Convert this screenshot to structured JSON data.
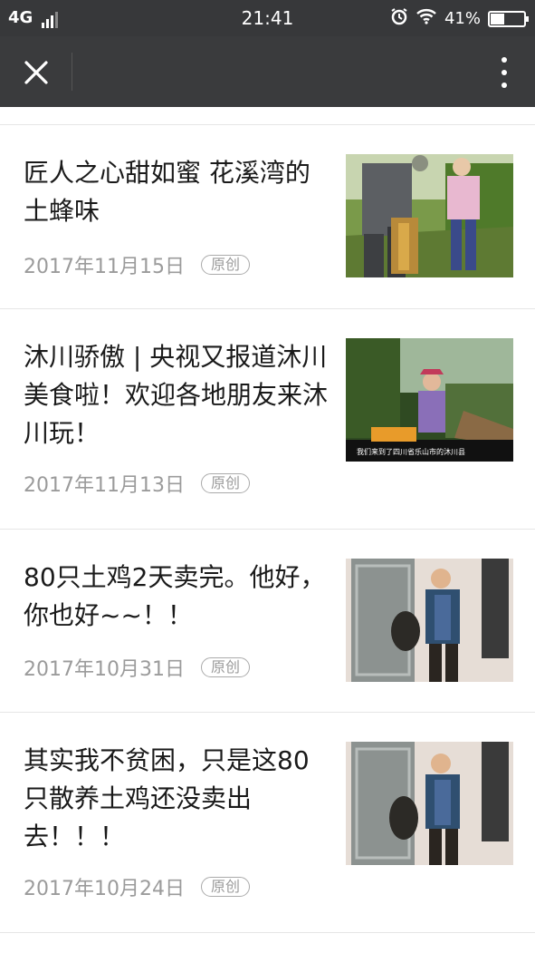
{
  "status_bar": {
    "network": "4G",
    "time": "21:41",
    "battery_percent": "41%",
    "battery_level": 0.41
  },
  "nav": {
    "close_icon": "close-icon",
    "more_icon": "more-vertical-icon"
  },
  "articles": [
    {
      "title": "匠人之心甜如蜜 花溪湾的土蜂味",
      "date": "2017年11月15日",
      "badge": "原创"
    },
    {
      "title": "沐川骄傲 | 央视又报道沐川美食啦！欢迎各地朋友来沐川玩！",
      "date": "2017年11月13日",
      "badge": "原创",
      "thumb_caption": "我们来到了四川省乐山市的沐川县"
    },
    {
      "title": "80只土鸡2天卖完。他好，你也好~~！！",
      "date": "2017年10月31日",
      "badge": "原创"
    },
    {
      "title": "其实我不贫困，只是这80只散养土鸡还没卖出去！！！",
      "date": "2017年10月24日",
      "badge": "原创"
    }
  ]
}
